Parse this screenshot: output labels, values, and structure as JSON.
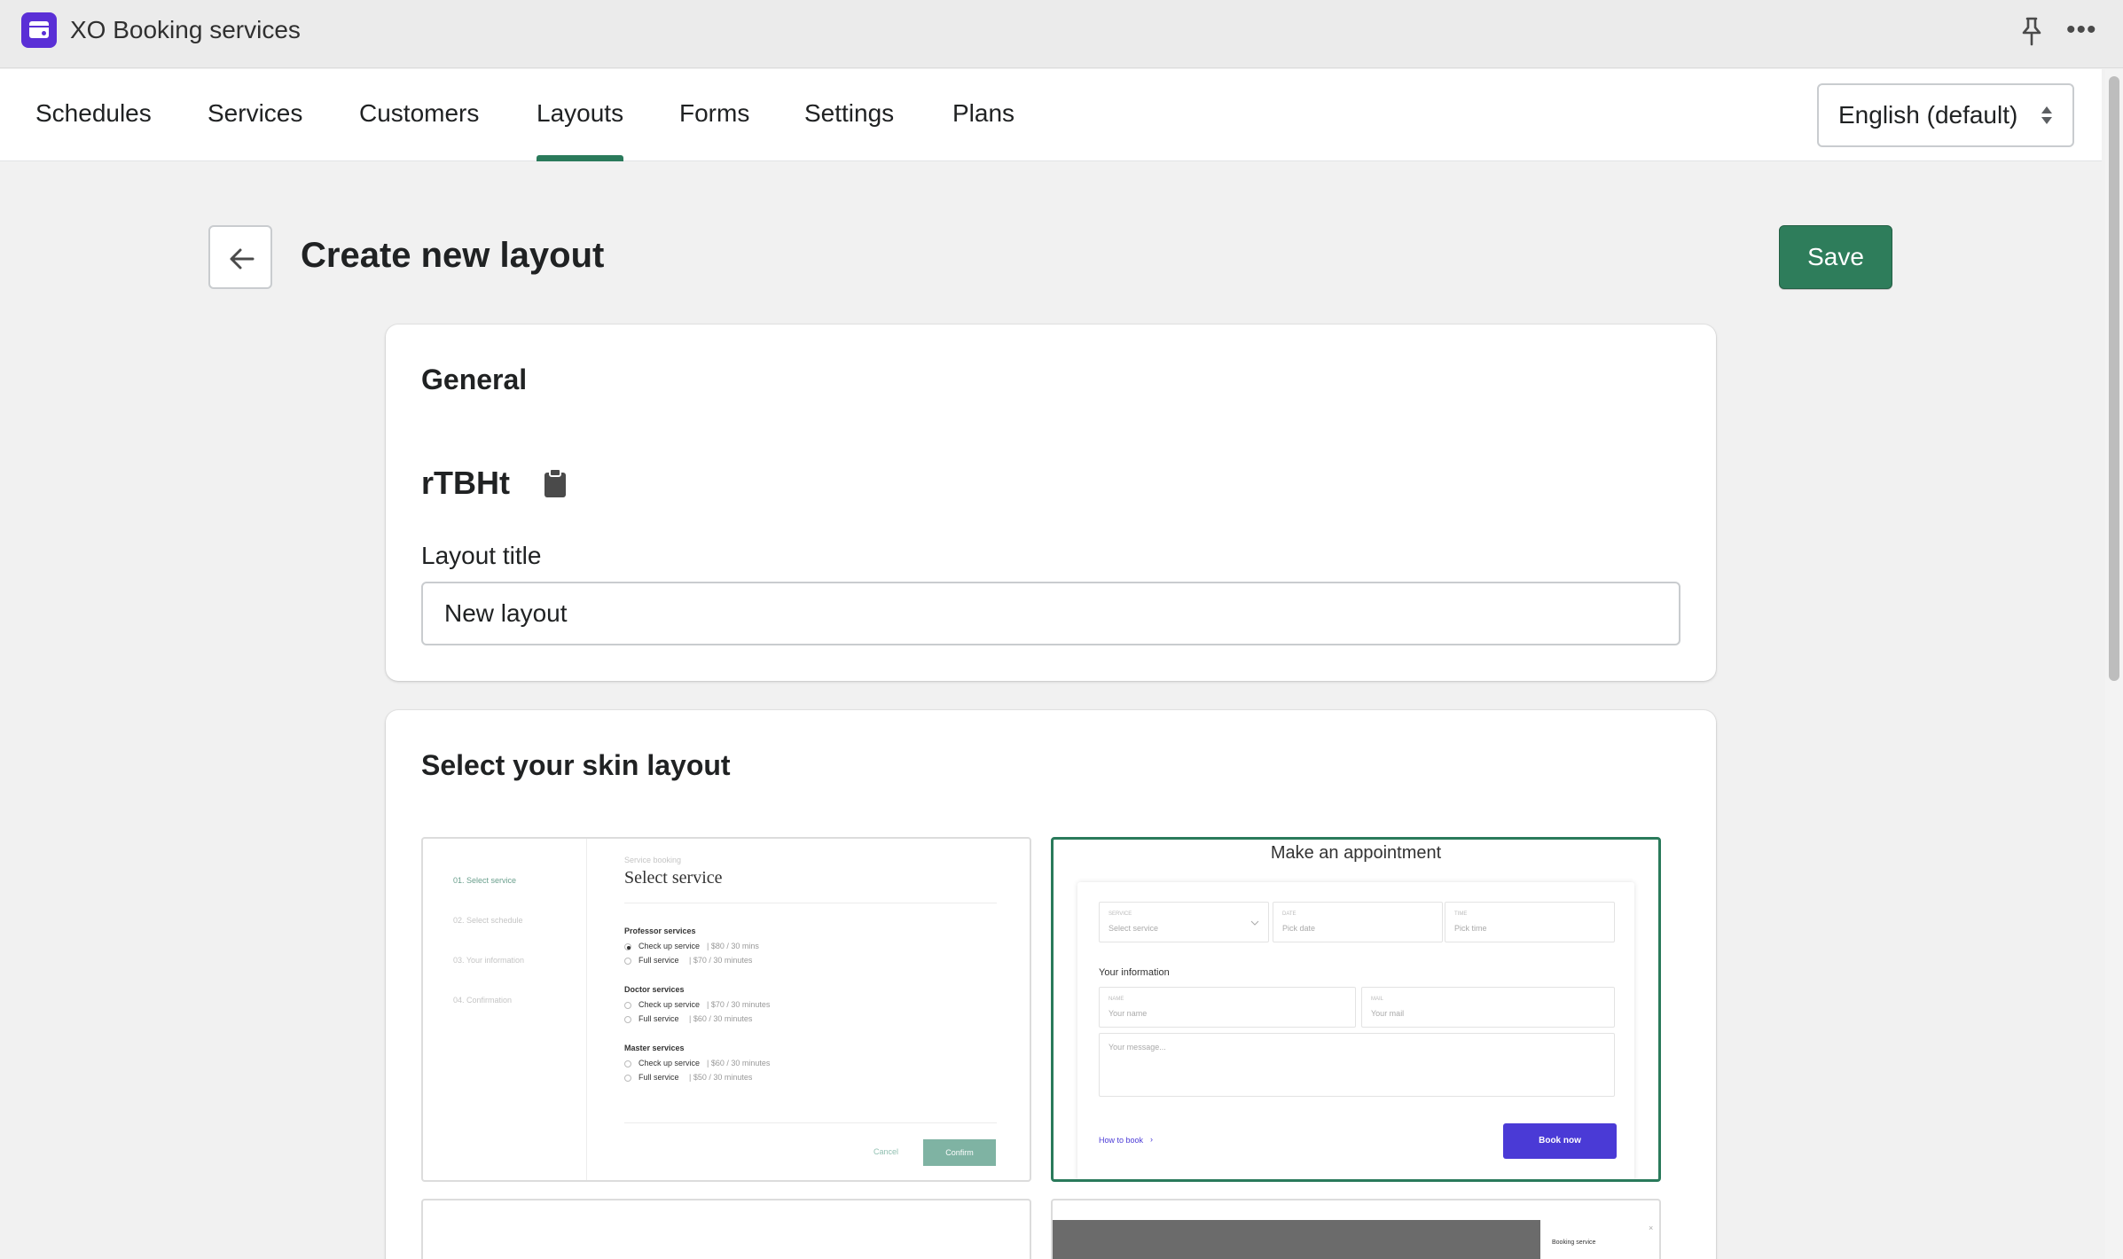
{
  "app": {
    "title": "XO Booking services",
    "icon": "calendar-app-icon"
  },
  "topbar": {
    "pin_icon": "pin-icon",
    "more_icon": "more-icon"
  },
  "nav": {
    "tabs": [
      {
        "label": "Schedules"
      },
      {
        "label": "Services"
      },
      {
        "label": "Customers"
      },
      {
        "label": "Layouts",
        "active": true
      },
      {
        "label": "Forms"
      },
      {
        "label": "Settings"
      },
      {
        "label": "Plans"
      }
    ],
    "language": "English (default)"
  },
  "page": {
    "title": "Create new layout",
    "save_label": "Save"
  },
  "general": {
    "heading": "General",
    "code": "rTBHt",
    "title_label": "Layout title",
    "title_value": "New layout"
  },
  "skins": {
    "heading": "Select your skin layout",
    "selected_index": 1,
    "skin1": {
      "steps": [
        "01. Select service",
        "02. Select schedule",
        "03. Your information",
        "04. Confirmation"
      ],
      "kicker": "Service booking",
      "title": "Select service",
      "groups": [
        {
          "name": "Professor services",
          "items": [
            {
              "name": "Check up service",
              "detail": "| $80 / 30 mins"
            },
            {
              "name": "Full service",
              "detail": "| $70 / 30 minutes"
            }
          ]
        },
        {
          "name": "Doctor services",
          "items": [
            {
              "name": "Check up service",
              "detail": "| $70 / 30 minutes"
            },
            {
              "name": "Full service",
              "detail": "| $60 / 30 minutes"
            }
          ]
        },
        {
          "name": "Master services",
          "items": [
            {
              "name": "Check up service",
              "detail": "| $60 / 30 minutes"
            },
            {
              "name": "Full service",
              "detail": "| $50 / 30 minutes"
            }
          ]
        }
      ],
      "cancel": "Cancel",
      "confirm": "Confirm",
      "accent": "#7fb3a3"
    },
    "skin2": {
      "title": "Make an appointment",
      "service_label": "SERVICE",
      "service_ph": "Select service",
      "date_label": "DATE",
      "date_ph": "Pick date",
      "time_label": "TIME",
      "time_ph": "Pick time",
      "info_heading": "Your information",
      "name_label": "NAME",
      "name_ph": "Your name",
      "mail_label": "MAIL",
      "mail_ph": "Your mail",
      "message_ph": "Your message...",
      "how_to": "How to book",
      "book": "Book now",
      "accent": "#4a3ad6"
    },
    "skin4": {
      "label": "Booking service"
    }
  },
  "colors": {
    "primary": "#2e7d5b",
    "app_brand": "#5a2fd6"
  }
}
